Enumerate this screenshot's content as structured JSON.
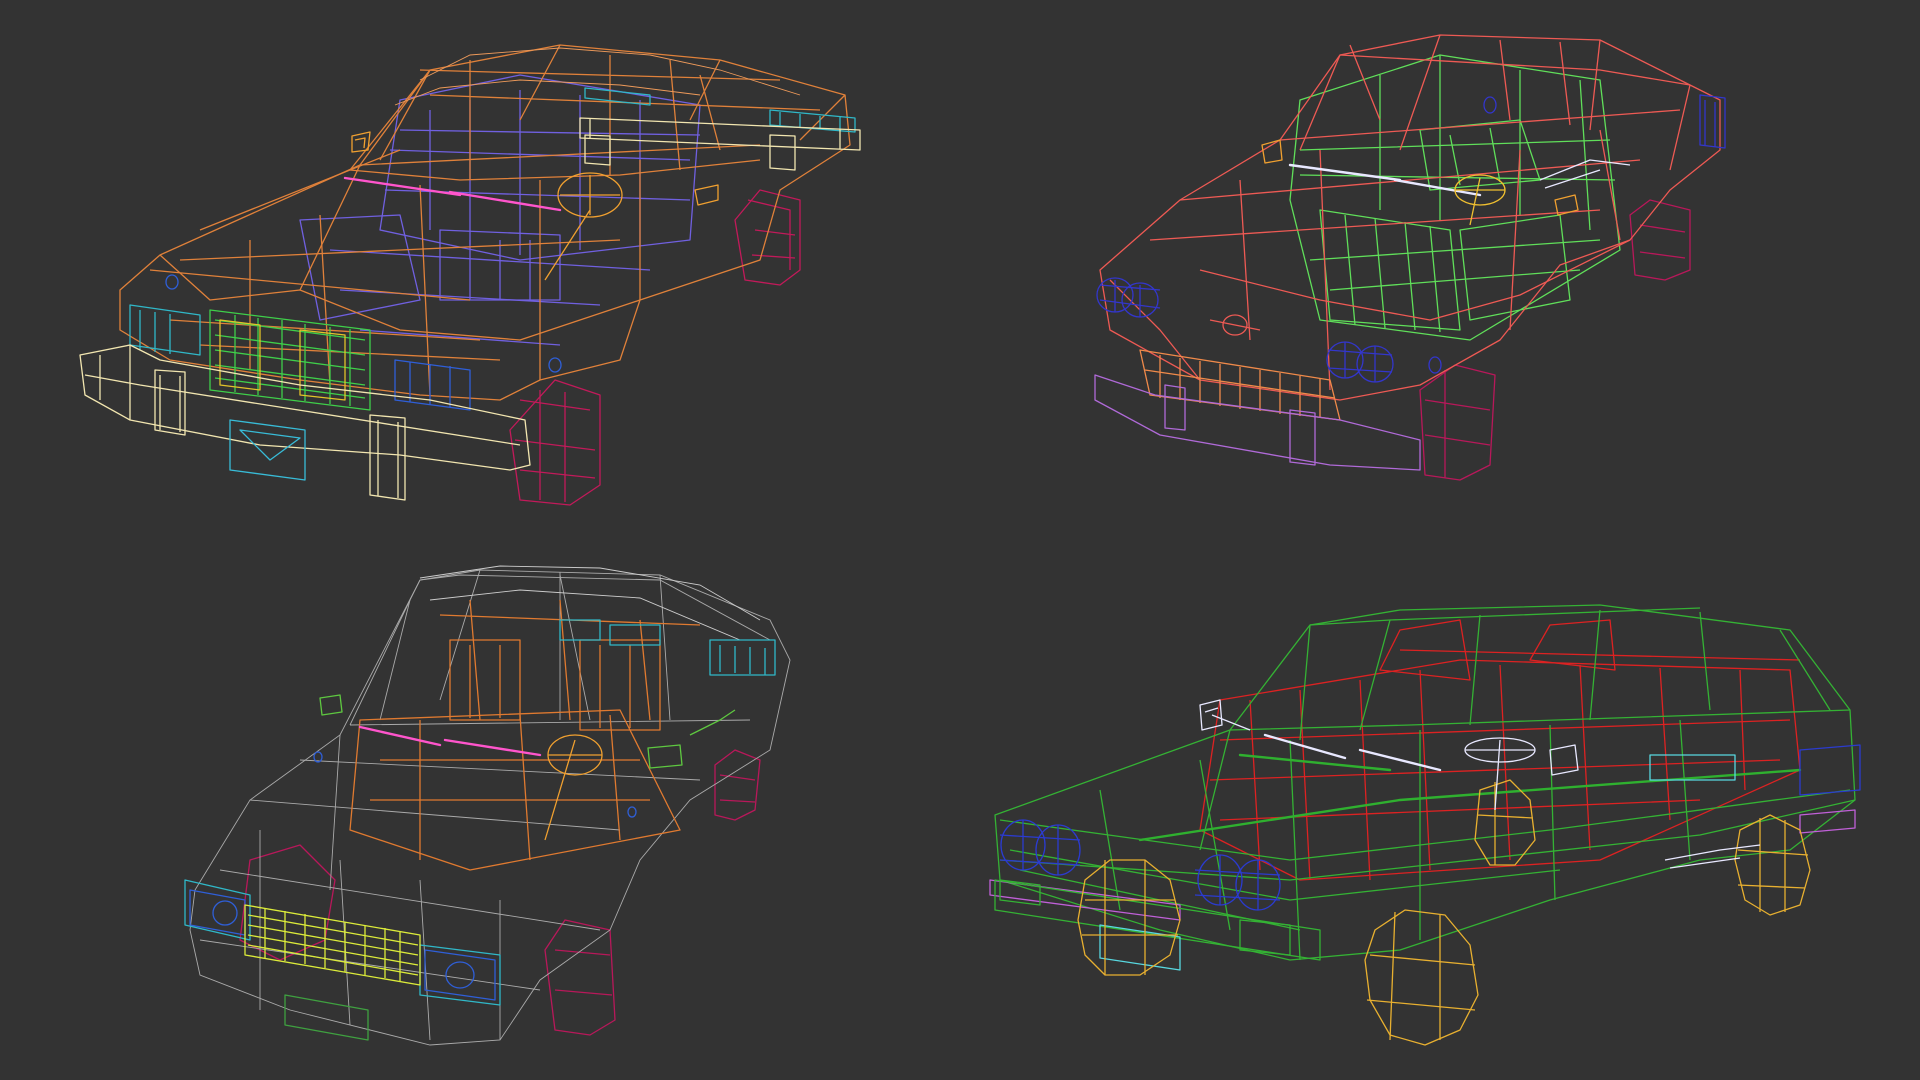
{
  "scene": {
    "background": "#333333",
    "models": [
      {
        "id": "sedan-top-left",
        "colors": {
          "body": "#e0813a",
          "interior": "#7060e0",
          "bumper": "#f2e6b0",
          "grille_a": "#3fcf4a",
          "grille_b": "#e2c32a",
          "wheel": "#c21a5a",
          "wiper": "#ff55cc",
          "plate": "#38bcd8",
          "steering": "#f0a030",
          "mirror": "#f0a030",
          "trim": "#30b8c8"
        }
      },
      {
        "id": "coupe-top-right",
        "colors": {
          "body": "#ee5a54",
          "interior": "#60df5a",
          "headlight": "#3336cc",
          "bumper": "#b06ad8",
          "grille": "#f08a4a",
          "wheel": "#b8185a",
          "wiper": "#e8e8ff",
          "steering": "#f0c030",
          "mirror": "#f0a030"
        }
      },
      {
        "id": "sedan-bottom-left",
        "colors": {
          "body": "#aaaaaa",
          "interior": "#e07a30",
          "headlight": "#2f5fd8",
          "grille": "#dcec3a",
          "wheel": "#b8185a",
          "wiper": "#ff55cc",
          "plate": "#3fa040",
          "steering": "#f0a030",
          "mirror": "#5ec840",
          "trim": "#30b8c8"
        }
      },
      {
        "id": "hatchback-bottom-right",
        "colors": {
          "body": "#34b234",
          "interior": "#dd2222",
          "headlight": "#2b3bd0",
          "wheel": "#e8b030",
          "wiper": "#e8e8ff",
          "plate": "#58d8e0",
          "steering": "#e8e8ff",
          "mirror": "#e8e8ff",
          "trim": "#c060d8"
        }
      }
    ]
  }
}
